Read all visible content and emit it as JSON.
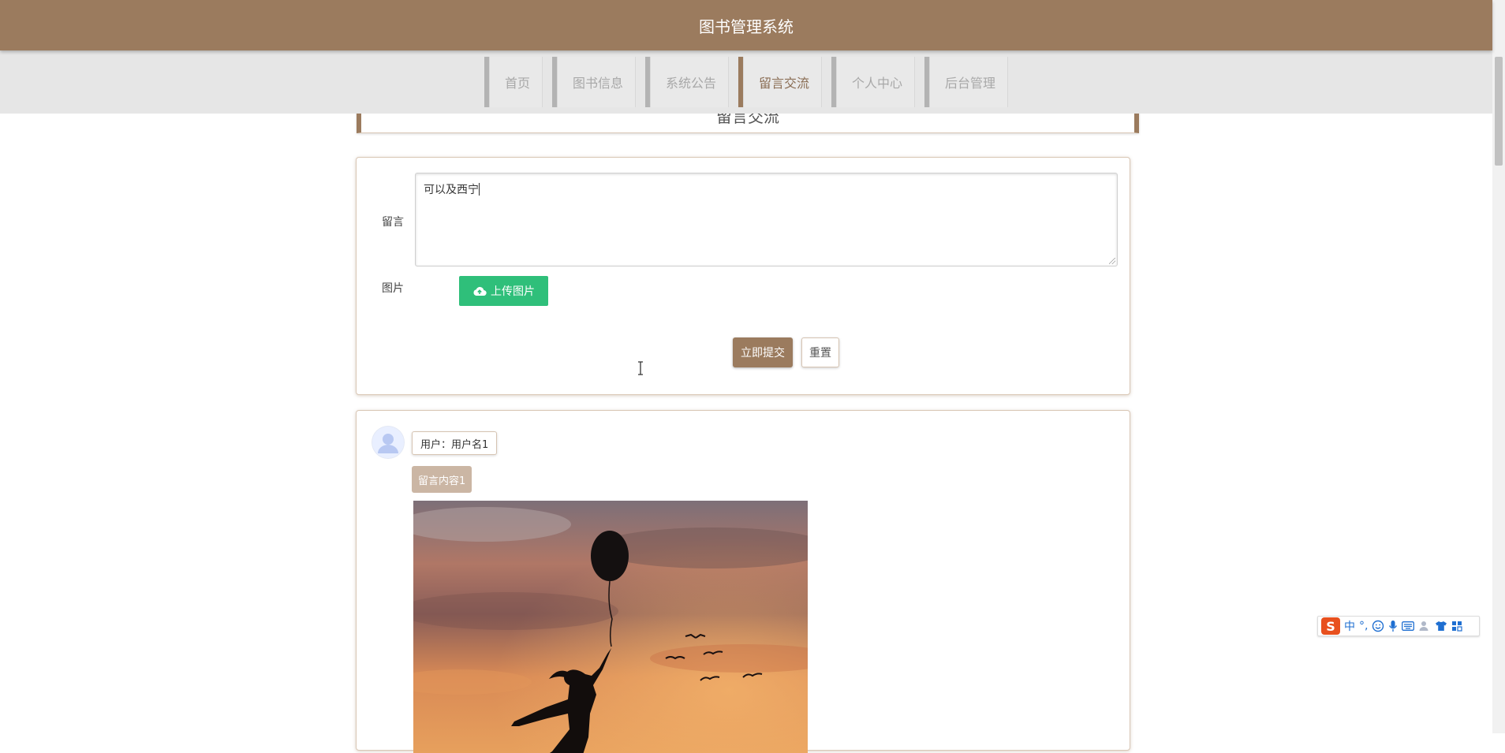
{
  "header": {
    "title": "图书管理系统",
    "bg_color": "#9b7b5e"
  },
  "nav": {
    "items": [
      {
        "label": "首页",
        "active": false
      },
      {
        "label": "图书信息",
        "active": false
      },
      {
        "label": "系统公告",
        "active": false
      },
      {
        "label": "留言交流",
        "active": true
      },
      {
        "label": "个人中心",
        "active": false
      },
      {
        "label": "后台管理",
        "active": false
      }
    ]
  },
  "section_title": "留言交流",
  "form": {
    "message_label": "留言",
    "message_value": "可以及西宁",
    "image_label": "图片",
    "upload_label": "上传图片",
    "submit_label": "立即提交",
    "reset_label": "重置"
  },
  "messages": [
    {
      "user_label": "用户：用户名1",
      "content": "留言内容1",
      "image": "silhouette-girl-balloon-sunset"
    }
  ],
  "ime": {
    "logo": "S",
    "mode": "中",
    "punct": "°,"
  },
  "colors": {
    "accent": "#9b7b5e",
    "upload": "#2fbf7a",
    "content_tag": "#cbb6a4"
  }
}
